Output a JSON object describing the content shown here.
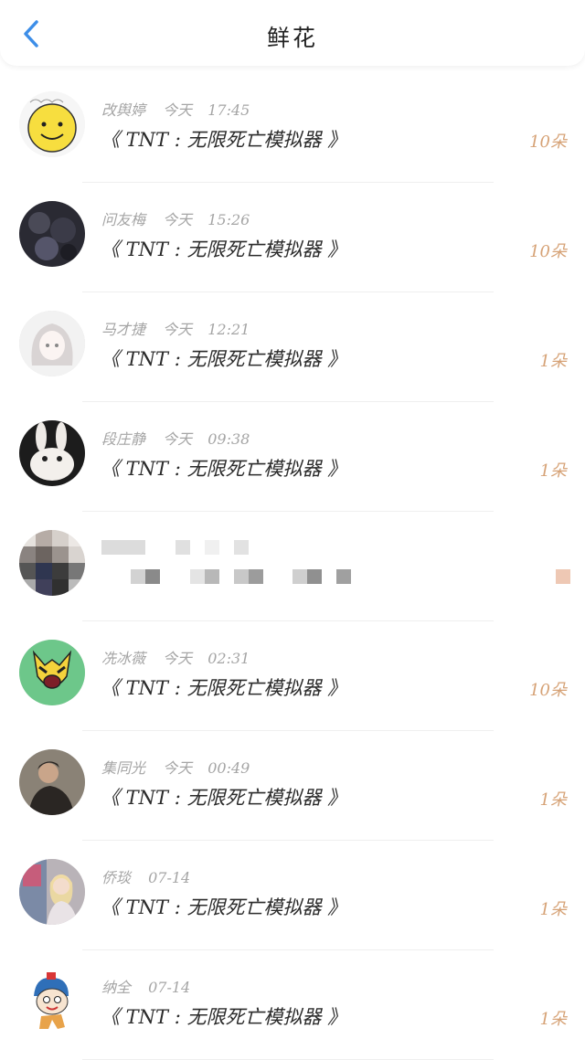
{
  "header": {
    "title": "鲜花",
    "back_icon": "chevron-left-icon",
    "accent": "#3d8ee8"
  },
  "items": [
    {
      "name": "改舆婷",
      "day": "今天",
      "time": "17:45",
      "book": "《 TNT : 无限死亡模拟器 》",
      "count": "10朵",
      "avatar": "smiley-face"
    },
    {
      "name": "问友梅",
      "day": "今天",
      "time": "15:26",
      "book": "《 TNT : 无限死亡模拟器 》",
      "count": "10朵",
      "avatar": "dark-photo"
    },
    {
      "name": "马才捷",
      "day": "今天",
      "time": "12:21",
      "book": "《 TNT : 无限死亡模拟器 》",
      "count": "1朵",
      "avatar": "anime-girl"
    },
    {
      "name": "段庄静",
      "day": "今天",
      "time": "09:38",
      "book": "《 TNT : 无限死亡模拟器 》",
      "count": "1朵",
      "avatar": "rabbit"
    },
    {
      "name": "",
      "day": "",
      "time": "",
      "book": "",
      "count": "",
      "avatar": "pixelated",
      "redacted": true
    },
    {
      "name": "冼冰薇",
      "day": "今天",
      "time": "02:31",
      "book": "《 TNT : 无限死亡模拟器 》",
      "count": "10朵",
      "avatar": "cartoon-wolverine"
    },
    {
      "name": "集同光",
      "day": "今天",
      "time": "00:49",
      "book": "《 TNT : 无限死亡模拟器 》",
      "count": "1朵",
      "avatar": "man-photo"
    },
    {
      "name": "侨琰",
      "day": "",
      "time": "07-14",
      "book": "《 TNT : 无限死亡模拟器 》",
      "count": "1朵",
      "avatar": "woman-photo"
    },
    {
      "name": "纳全",
      "day": "",
      "time": "07-14",
      "book": "《 TNT : 无限死亡模拟器 》",
      "count": "1朵",
      "avatar": "cartoon-boy"
    }
  ],
  "colors": {
    "count": "#d6a276",
    "meta": "#a5a5a5",
    "text": "#2b2b2b"
  }
}
